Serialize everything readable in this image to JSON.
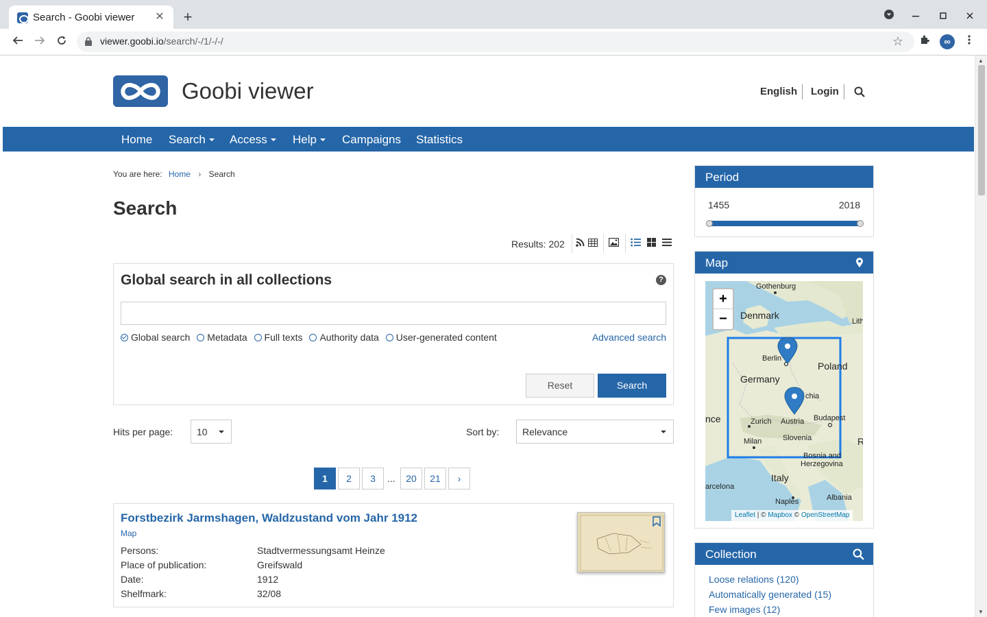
{
  "browser": {
    "tab_title": "Search - Goobi viewer",
    "tab_close": "✕",
    "new_tab": "+",
    "url_host": "viewer.goobi.io",
    "url_path": "/search/-/1/-/-/",
    "profile_initials": "∞"
  },
  "header": {
    "site_title": "Goobi viewer",
    "language": "English",
    "login": "Login"
  },
  "nav": {
    "items": [
      "Home",
      "Search",
      "Access",
      "Help",
      "Campaigns",
      "Statistics"
    ]
  },
  "breadcrumb": {
    "prefix": "You are here:",
    "home": "Home",
    "current": "Search"
  },
  "page_title": "Search",
  "results": {
    "label": "Results: 202"
  },
  "search_box": {
    "heading": "Global search in all collections",
    "help": "?",
    "query_value": "",
    "options": [
      "Global search",
      "Metadata",
      "Full texts",
      "Authority data",
      "User-generated content"
    ],
    "selected_option": "Global search",
    "advanced_link": "Advanced search",
    "reset_label": "Reset",
    "search_label": "Search"
  },
  "controls": {
    "hits_label": "Hits per page:",
    "hits_value": "10",
    "sort_label": "Sort by:",
    "sort_value": "Relevance"
  },
  "pagination": {
    "pages": [
      "1",
      "2",
      "3",
      "20",
      "21"
    ],
    "ellipsis": "...",
    "next": "›",
    "current": "1"
  },
  "result_items": [
    {
      "title": "Forstbezirk Jarmshagen, Waldzustand vom Jahr 1912",
      "type": "Map",
      "metadata": [
        {
          "label": "Persons:",
          "value": "Stadtvermessungsamt Heinze"
        },
        {
          "label": "Place of publication:",
          "value": "Greifswald"
        },
        {
          "label": "Date:",
          "value": "1912"
        },
        {
          "label": "Shelfmark:",
          "value": "32/08"
        }
      ]
    }
  ],
  "sidebar": {
    "period": {
      "title": "Period",
      "min": "1455",
      "max": "2018"
    },
    "map": {
      "title": "Map",
      "zoom_in": "+",
      "zoom_out": "−",
      "attribution_leaflet": "Leaflet",
      "attribution_mid": " | © ",
      "attribution_mapbox": "Mapbox",
      "attribution_osm": "OpenStreetMap",
      "labels": {
        "gothenburg": "Gothenburg",
        "denmark": "Denmark",
        "lith": "Lith",
        "berlin": "Berlin",
        "poland": "Poland",
        "germany": "Germany",
        "czechia": "chia",
        "ance": "nce",
        "zurich": "Zurich",
        "austria": "Austria",
        "budapest": "Budapest",
        "milan": "Milan",
        "slovenia": "Slovenia",
        "r": "R",
        "bosnia": "Bosnia and",
        "herzegovina": "Herzegovina",
        "italy": "Italy",
        "barcelona": "arcelona",
        "naples": "Naples",
        "albania": "Albania"
      }
    },
    "collection": {
      "title": "Collection",
      "items": [
        "Loose relations (120)",
        "Automatically generated (15)",
        "Few images (12)"
      ]
    }
  },
  "colors": {
    "primary": "#2566a8",
    "chrome": "#dee1e6"
  }
}
